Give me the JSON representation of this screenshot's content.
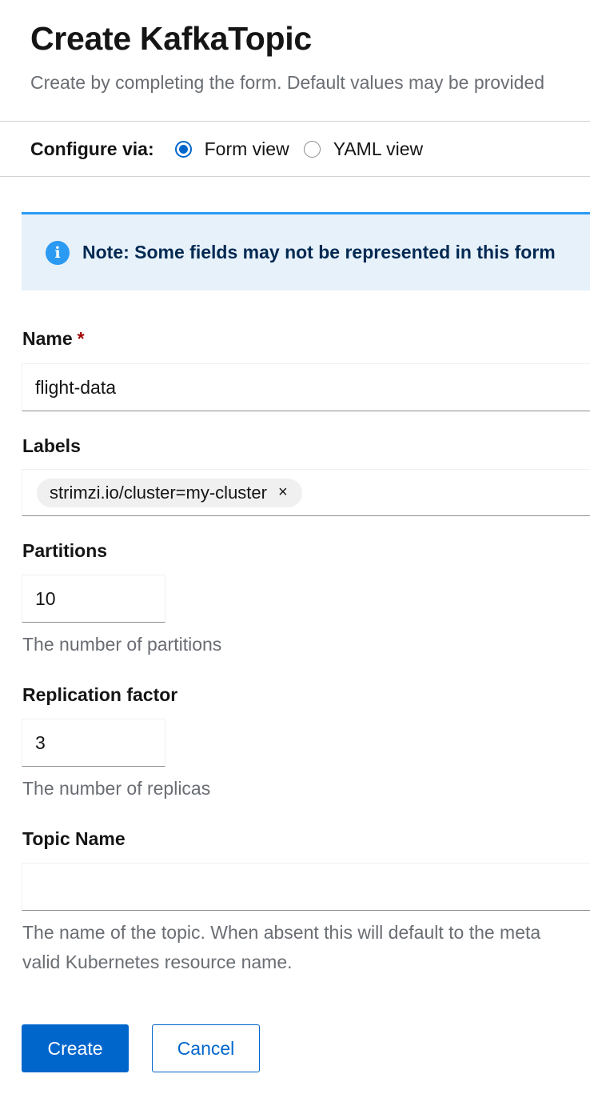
{
  "header": {
    "title": "Create KafkaTopic",
    "subtitle": "Create by completing the form. Default values may be provided"
  },
  "configure": {
    "label": "Configure via:",
    "options": [
      {
        "label": "Form view",
        "selected": true
      },
      {
        "label": "YAML view",
        "selected": false
      }
    ]
  },
  "alert": {
    "icon": "info-icon",
    "text": "Note: Some fields may not be represented in this form"
  },
  "form": {
    "name": {
      "label": "Name",
      "required_marker": "*",
      "value": "flight-data"
    },
    "labels": {
      "label": "Labels",
      "chips": [
        {
          "text": "strimzi.io/cluster=my-cluster",
          "close": "×"
        }
      ]
    },
    "partitions": {
      "label": "Partitions",
      "value": "10",
      "helper": "The number of partitions"
    },
    "replication_factor": {
      "label": "Replication factor",
      "value": "3",
      "helper": "The number of replicas"
    },
    "topic_name": {
      "label": "Topic Name",
      "value": "",
      "helper_line1": "The name of the topic. When absent this will default to the meta",
      "helper_line2": "valid Kubernetes resource name."
    }
  },
  "actions": {
    "create_label": "Create",
    "cancel_label": "Cancel"
  },
  "colors": {
    "primary": "#0066cc",
    "info": "#2b9af3",
    "alert_bg": "#e7f1fa",
    "required": "#a30000",
    "helper_text": "#6a6e73"
  }
}
